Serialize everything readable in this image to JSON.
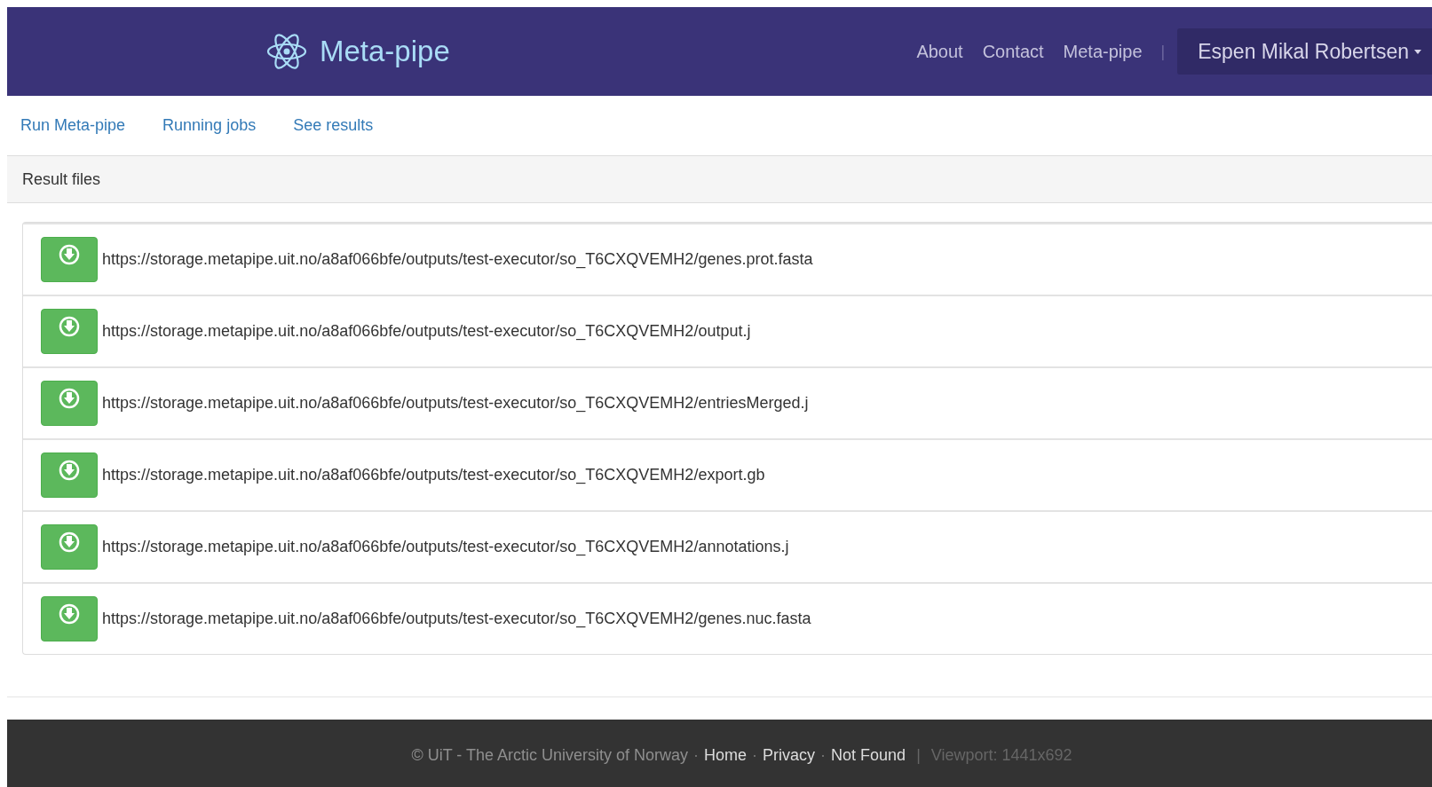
{
  "header": {
    "brand": "Meta-pipe",
    "nav": [
      "About",
      "Contact",
      "Meta-pipe"
    ],
    "separator": "|",
    "user": {
      "name": "Espen Mikal Robertsen",
      "expanded": false
    }
  },
  "subnav": [
    "Run Meta-pipe",
    "Running jobs",
    "See results"
  ],
  "panel": {
    "title": "Result files"
  },
  "files": [
    {
      "url": "https://storage.metapipe.uit.no/a8af066bfe/outputs/test-executor/so_T6CXQVEMH2/genes.prot.fasta"
    },
    {
      "url": "https://storage.metapipe.uit.no/a8af066bfe/outputs/test-executor/so_T6CXQVEMH2/output.j"
    },
    {
      "url": "https://storage.metapipe.uit.no/a8af066bfe/outputs/test-executor/so_T6CXQVEMH2/entriesMerged.j"
    },
    {
      "url": "https://storage.metapipe.uit.no/a8af066bfe/outputs/test-executor/so_T6CXQVEMH2/export.gb"
    },
    {
      "url": "https://storage.metapipe.uit.no/a8af066bfe/outputs/test-executor/so_T6CXQVEMH2/annotations.j"
    },
    {
      "url": "https://storage.metapipe.uit.no/a8af066bfe/outputs/test-executor/so_T6CXQVEMH2/genes.nuc.fasta"
    }
  ],
  "footer": [
    {
      "kind": "text",
      "text": "© UiT - The Arctic University of Norway"
    },
    {
      "kind": "dot",
      "text": "·"
    },
    {
      "kind": "link",
      "text": "Home"
    },
    {
      "kind": "dot",
      "text": "·"
    },
    {
      "kind": "link",
      "text": "Privacy"
    },
    {
      "kind": "dot",
      "text": "·"
    },
    {
      "kind": "link",
      "text": "Not Found"
    },
    {
      "kind": "bar",
      "text": "|"
    },
    {
      "kind": "muted",
      "text": "Viewport: 1441x692"
    }
  ]
}
